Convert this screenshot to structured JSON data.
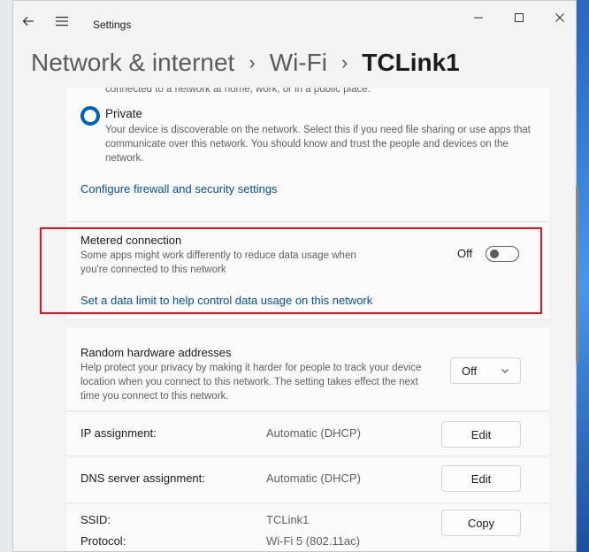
{
  "window": {
    "app_title": "Settings",
    "caption_icons": [
      "minimize-icon",
      "maximize-icon",
      "close-icon"
    ]
  },
  "breadcrumb": {
    "items": [
      "Network & internet",
      "Wi-Fi"
    ],
    "current": "TCLink1",
    "separator": "›"
  },
  "network_profile": {
    "cut_off_text": "connected to a network at home, work, or in a public place.",
    "private_label": "Private",
    "private_description": "Your device is discoverable on the network. Select this if you need file sharing or use apps that communicate over this network. You should know and trust the people and devices on the network.",
    "firewall_link": "Configure firewall and security settings"
  },
  "metered": {
    "title": "Metered connection",
    "description": "Some apps might work differently to reduce data usage when you're connected to this network",
    "toggle_state_label": "Off",
    "toggle_on": false,
    "data_limit_link": "Set a data limit to help control data usage on this network"
  },
  "random_hw": {
    "title": "Random hardware addresses",
    "description": "Help protect your privacy by making it harder for people to track your device location when you connect to this network. The setting takes effect the next time you connect to this network.",
    "dropdown_value": "Off"
  },
  "ip_assignment": {
    "label": "IP assignment:",
    "value": "Automatic (DHCP)",
    "button": "Edit"
  },
  "dns_assignment": {
    "label": "DNS server assignment:",
    "value": "Automatic (DHCP)",
    "button": "Edit"
  },
  "properties": {
    "ssid_label": "SSID:",
    "ssid_value": "TCLink1",
    "protocol_label": "Protocol:",
    "protocol_value": "Wi-Fi 5 (802.11ac)",
    "copy_button": "Copy"
  },
  "colors": {
    "accent": "#005fb8",
    "link": "#0b4d8c",
    "highlight_border": "#e81123"
  }
}
